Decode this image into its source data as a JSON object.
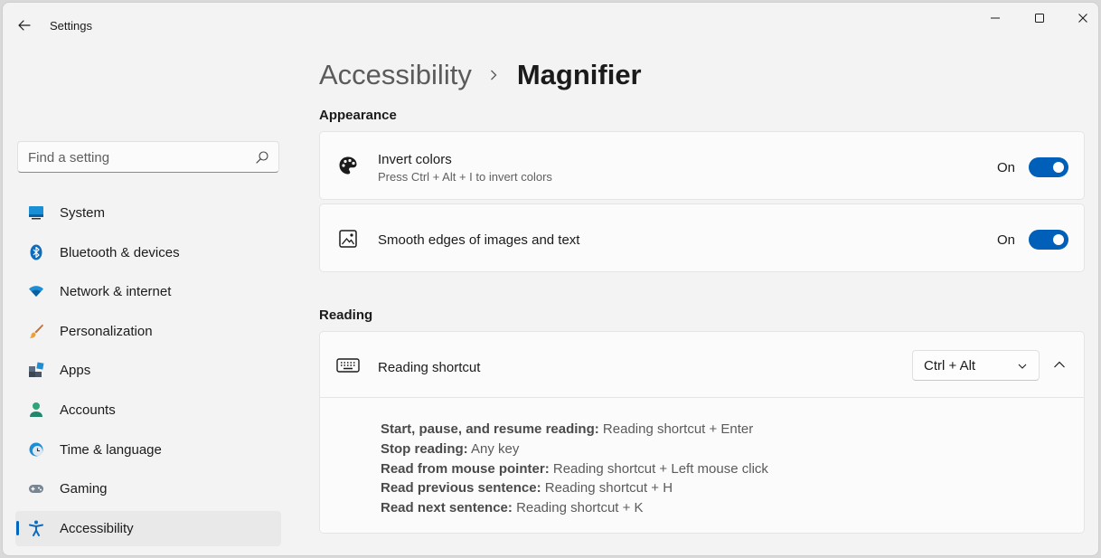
{
  "app": {
    "title": "Settings"
  },
  "search": {
    "placeholder": "Find a setting"
  },
  "sidebar": {
    "items": [
      {
        "label": "System",
        "icon": "system-icon"
      },
      {
        "label": "Bluetooth & devices",
        "icon": "bluetooth-icon"
      },
      {
        "label": "Network & internet",
        "icon": "network-icon"
      },
      {
        "label": "Personalization",
        "icon": "brush-icon"
      },
      {
        "label": "Apps",
        "icon": "apps-icon"
      },
      {
        "label": "Accounts",
        "icon": "accounts-icon"
      },
      {
        "label": "Time & language",
        "icon": "time-language-icon"
      },
      {
        "label": "Gaming",
        "icon": "gamepad-icon"
      },
      {
        "label": "Accessibility",
        "icon": "accessibility-icon",
        "active": true
      }
    ]
  },
  "breadcrumb": {
    "parent": "Accessibility",
    "current": "Magnifier"
  },
  "appearance": {
    "title": "Appearance",
    "invert": {
      "title": "Invert colors",
      "subtitle": "Press Ctrl + Alt + I to invert colors",
      "state": "On"
    },
    "smooth": {
      "title": "Smooth edges of images and text",
      "state": "On"
    }
  },
  "reading": {
    "title": "Reading",
    "shortcut": {
      "title": "Reading shortcut",
      "value": "Ctrl + Alt",
      "lines": [
        {
          "label": "Start, pause, and resume reading:",
          "value": "Reading shortcut + Enter"
        },
        {
          "label": "Stop reading:",
          "value": "Any key"
        },
        {
          "label": "Read from mouse pointer:",
          "value": "Reading shortcut + Left mouse click"
        },
        {
          "label": "Read previous sentence:",
          "value": "Reading shortcut + H"
        },
        {
          "label": "Read next sentence:",
          "value": "Reading shortcut + K"
        }
      ]
    }
  },
  "colors": {
    "accent": "#005fb8",
    "active_indicator": "#0067c0"
  }
}
